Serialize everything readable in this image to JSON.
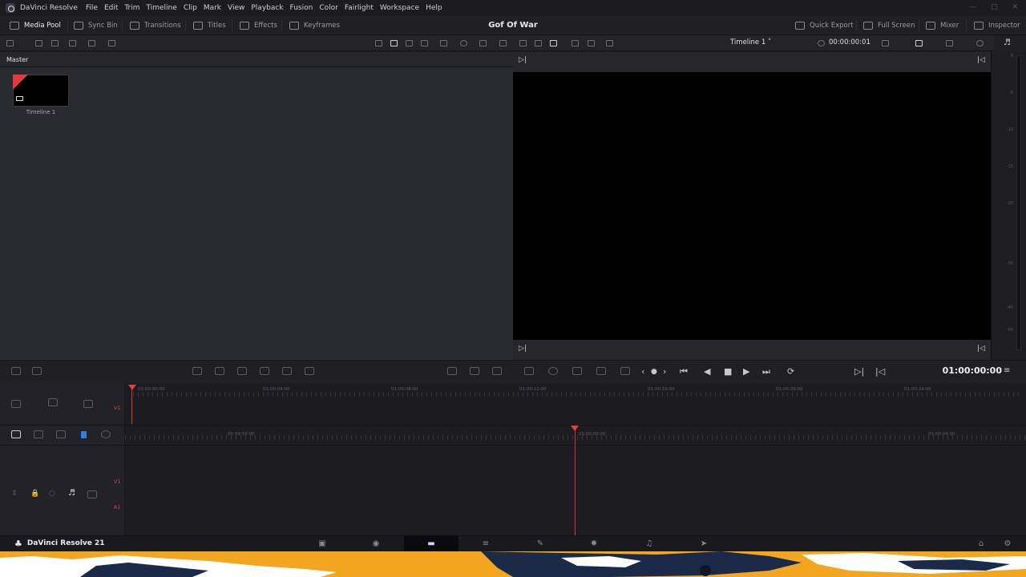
{
  "app": {
    "name": "DaVinci Resolve"
  },
  "menu": [
    "File",
    "Edit",
    "Trim",
    "Timeline",
    "Clip",
    "Mark",
    "View",
    "Playback",
    "Fusion",
    "Color",
    "Fairlight",
    "Workspace",
    "Help"
  ],
  "toolbar": {
    "media_pool": "Media Pool",
    "sync_bin": "Sync Bin",
    "transitions": "Transitions",
    "titles": "Titles",
    "effects": "Effects",
    "keyframes": "Keyframes",
    "quick_export": "Quick Export",
    "full_screen": "Full Screen",
    "mixer": "Mixer",
    "inspector": "Inspector"
  },
  "project": {
    "title": "Gof Of War"
  },
  "viewer": {
    "timeline_name": "Timeline 1",
    "timecode_top": "00:00:00:01",
    "timecode_main": "01:00:00:00"
  },
  "pool": {
    "bin": "Master",
    "clips": [
      {
        "label": "Timeline 1"
      }
    ]
  },
  "meter_scale": [
    "0",
    "-5",
    "-10",
    "-15",
    "-20",
    "-30",
    "-40",
    "-50"
  ],
  "upper_ruler": [
    "01:00:00:00",
    "01:00:04:00",
    "01:00:08:00",
    "01:00:12:00",
    "01:00:16:00",
    "01:00:20:00",
    "01:00:24:00"
  ],
  "lower_ruler": [
    "00:59:56:00",
    "01:00:00:00",
    "01:00:04:00"
  ],
  "tracks": {
    "v1": "V1",
    "a1": "A1"
  },
  "brand": {
    "label": "DaVinci Resolve 21"
  },
  "colors": {
    "accent": "#e04040",
    "strip": "#f3a620"
  }
}
